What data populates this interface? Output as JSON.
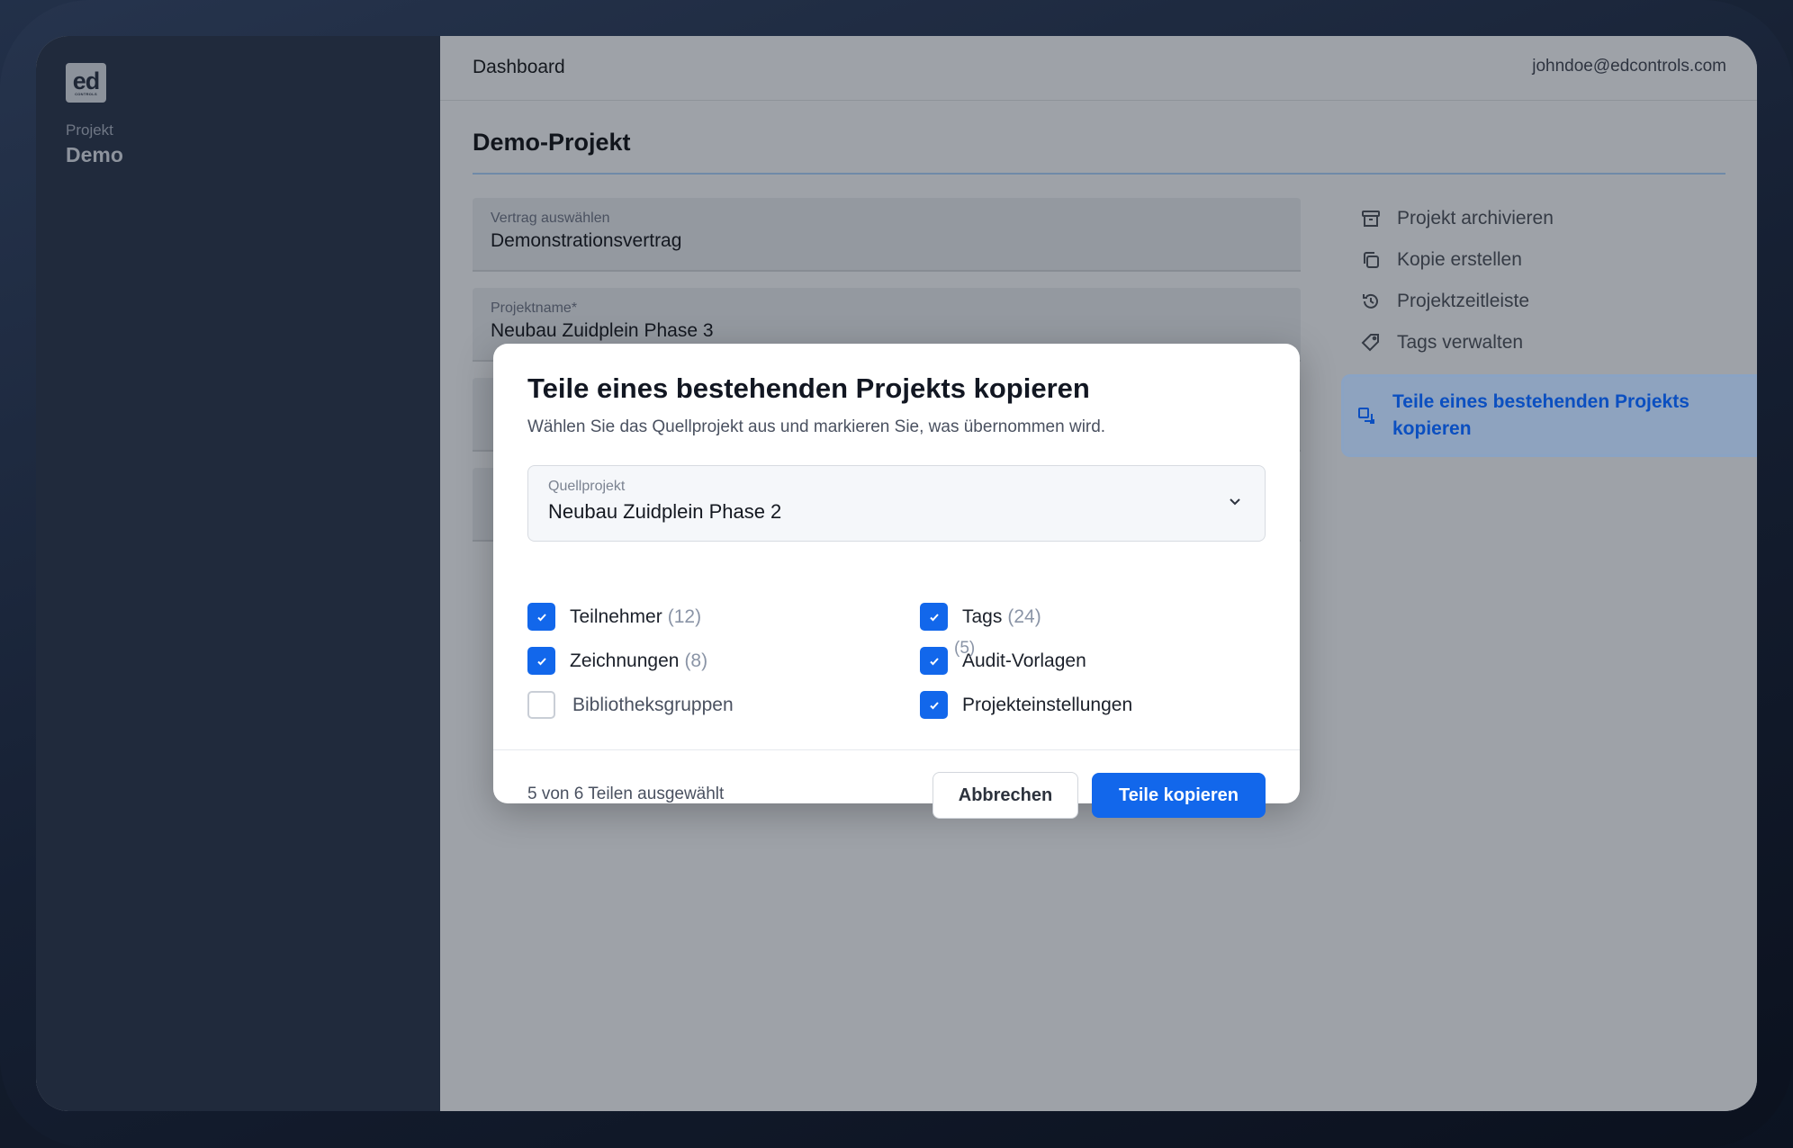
{
  "sidebar": {
    "logo_text": "ed",
    "logo_subtext": "CONTROLS",
    "project_label": "Projekt",
    "project_value": "Demo"
  },
  "topbar": {
    "title": "Dashboard",
    "user_email": "johndoe@edcontrols.com"
  },
  "page": {
    "title": "Demo-Projekt",
    "fields": [
      {
        "label": "Vertrag auswählen",
        "value": "Demonstrationsvertrag"
      },
      {
        "label": "Projektname*",
        "value": "Neubau Zuidplein Phase 3"
      }
    ]
  },
  "actions": [
    {
      "label": "Projekt archivieren",
      "icon": "archive-icon"
    },
    {
      "label": "Kopie erstellen",
      "icon": "copy-icon"
    },
    {
      "label": "Projektzeitleiste",
      "icon": "history-icon"
    },
    {
      "label": "Tags verwalten",
      "icon": "tag-icon"
    },
    {
      "label_line1": "Teile eines bestehenden Projekts",
      "label_line2": "kopieren",
      "icon": "copy-parts-icon",
      "active": true
    }
  ],
  "modal": {
    "title": "Teile eines bestehenden Projekts kopieren",
    "subtitle": "Wählen Sie das Quellprojekt aus und markieren Sie, was übernommen wird.",
    "source": {
      "label": "Quellprojekt",
      "value": "Neubau Zuidplein Phase 2"
    },
    "parts": [
      {
        "label": "Teilnehmer",
        "count": "(12)",
        "checked": true
      },
      {
        "label": "Tags",
        "count": "(24)",
        "checked": true
      },
      {
        "label": "Zeichnungen",
        "count": "(8)",
        "checked": true
      },
      {
        "label": "Audit-Vorlagen",
        "count": "(5)",
        "checked": true
      },
      {
        "label": "Bibliotheksgruppen",
        "count": "",
        "checked": false
      },
      {
        "label": "Projekteinstellungen",
        "count": "",
        "checked": true
      }
    ],
    "selection_summary": "5 von 6 Teilen ausgewählt",
    "cancel_label": "Abbrechen",
    "confirm_label": "Teile kopieren"
  },
  "colors": {
    "accent": "#1267eb",
    "sidebar_bg": "#202a3c",
    "overlay_bg": "#9ea2a8"
  }
}
